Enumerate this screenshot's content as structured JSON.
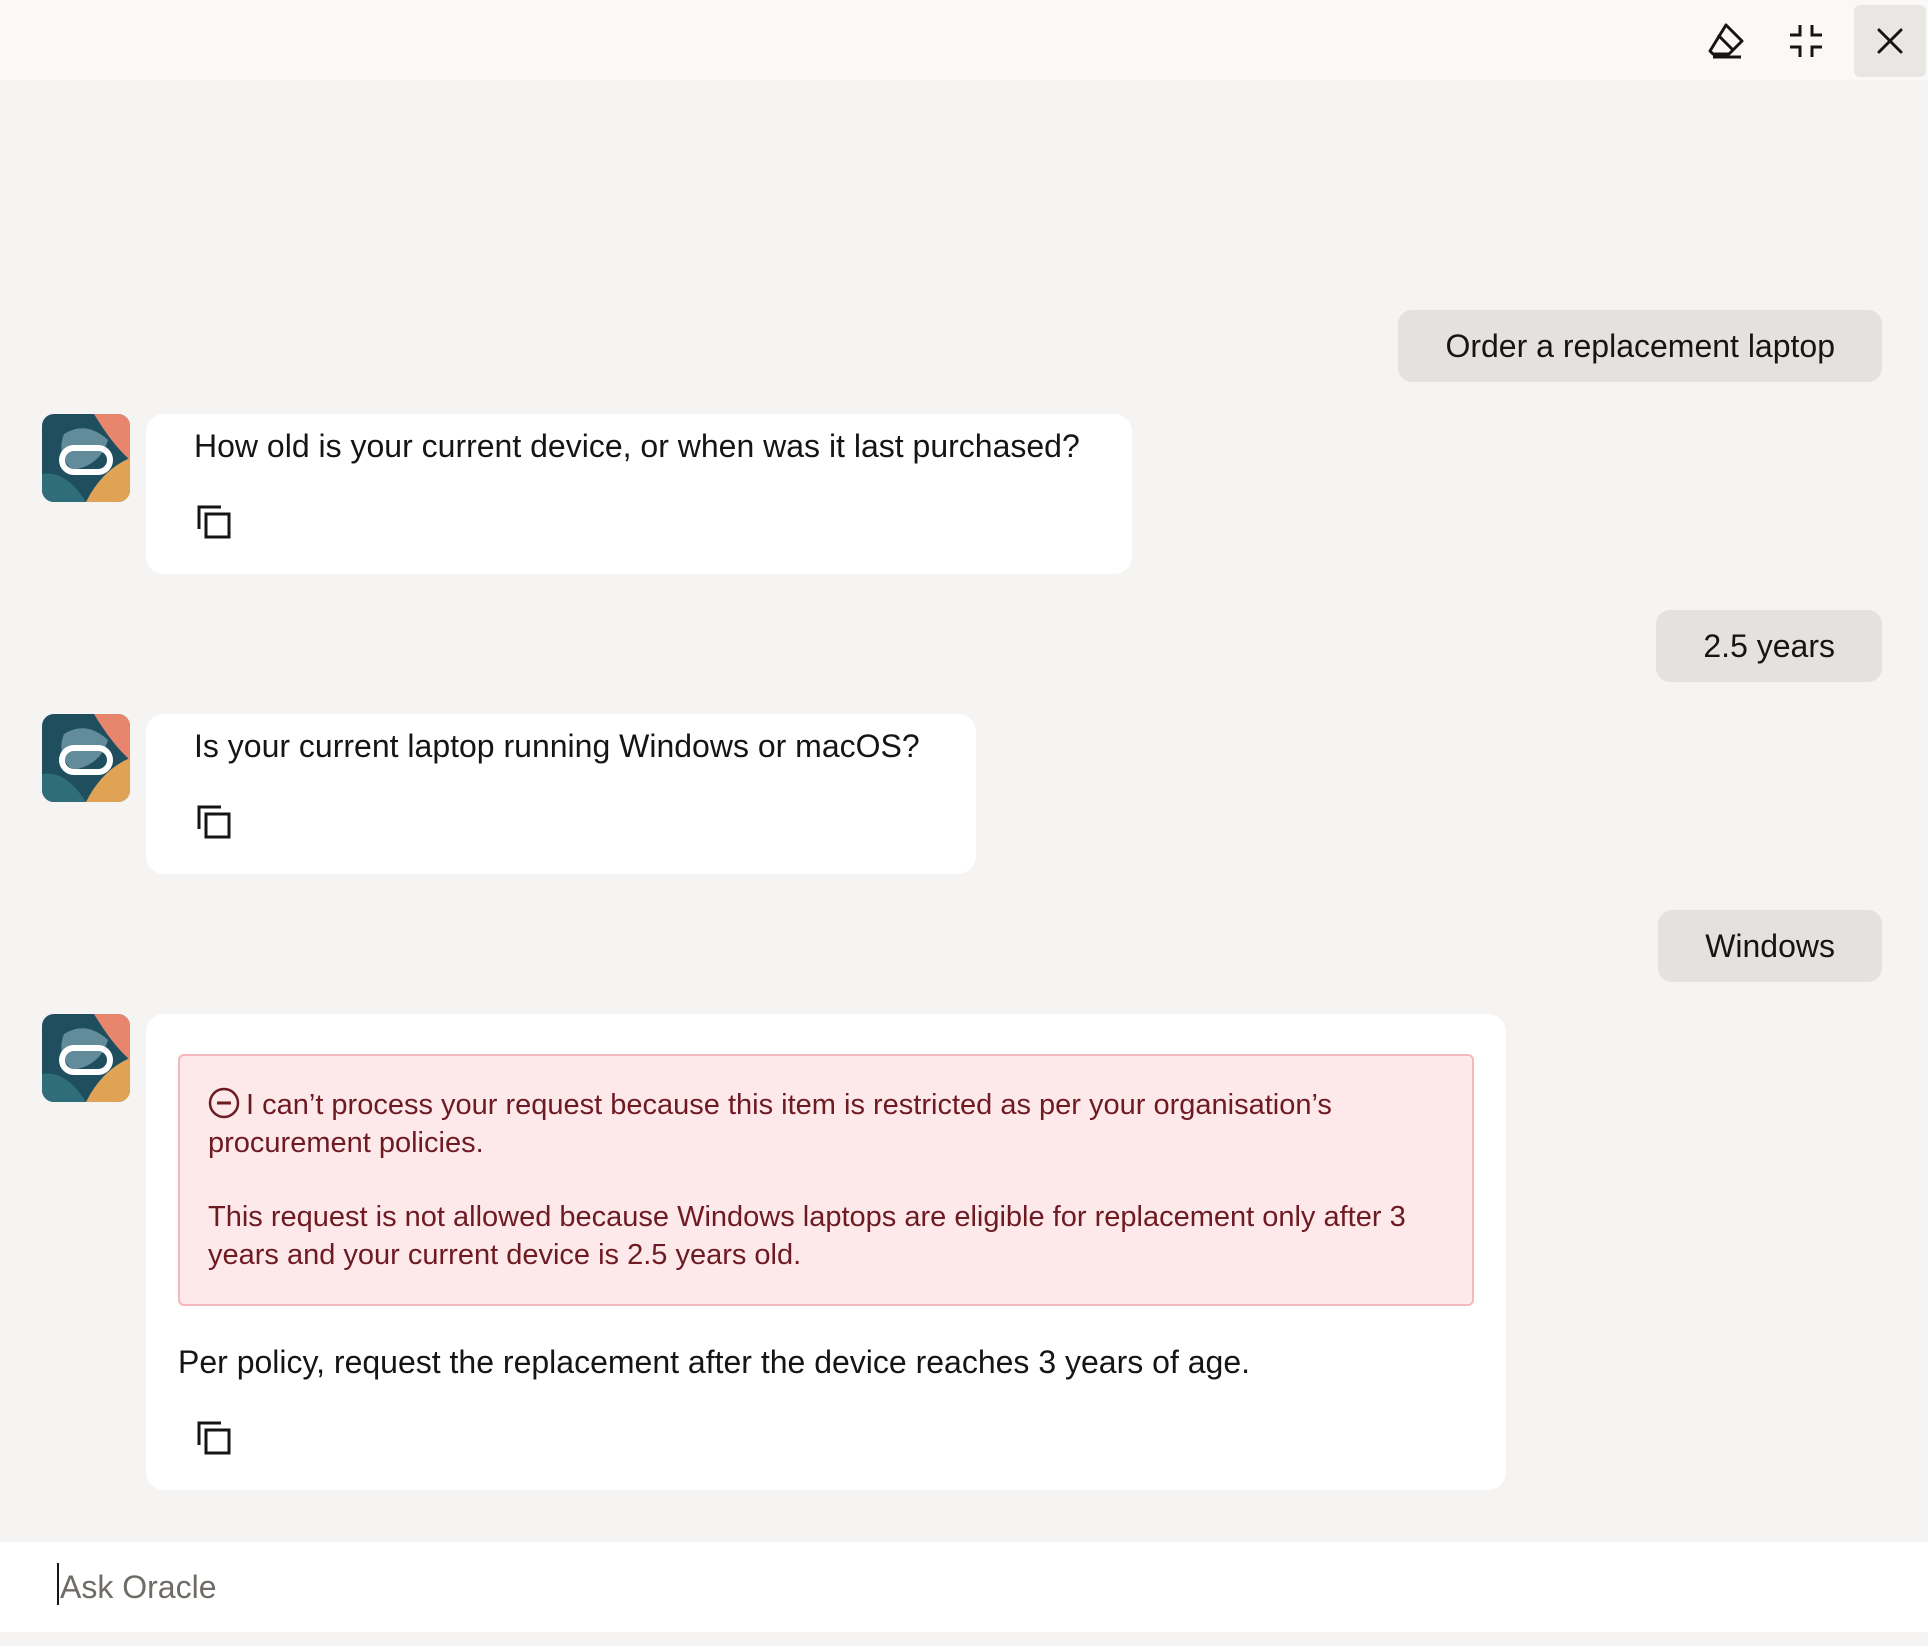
{
  "toolbar": {
    "clear_icon": "eraser-icon",
    "collapse_icon": "collapse-icon",
    "close_icon": "close-icon"
  },
  "messages": [
    {
      "role": "user",
      "text": "Order a replacement laptop"
    },
    {
      "role": "assistant",
      "text": "How old is your current device, or when was it last purchased?"
    },
    {
      "role": "user",
      "text": "2.5 years"
    },
    {
      "role": "assistant",
      "text": "Is your current laptop running Windows or macOS?"
    },
    {
      "role": "user",
      "text": "Windows"
    },
    {
      "role": "assistant",
      "error": {
        "line1": "I can’t process your request because this item is restricted as per your organisation’s procurement policies.",
        "line2": "This request is not allowed because Windows laptops are eligible for replacement only after 3 years and your current device is 2.5 years old."
      },
      "text": "Per policy, request the replacement after the device reaches 3 years of age."
    }
  ],
  "input": {
    "placeholder": "Ask Oracle"
  },
  "colors": {
    "background": "#f5f4f2",
    "user_bubble": "#e4e2df",
    "error_bg": "#fde9ea",
    "error_border": "#f2b8bb",
    "error_text": "#6e1a22"
  }
}
